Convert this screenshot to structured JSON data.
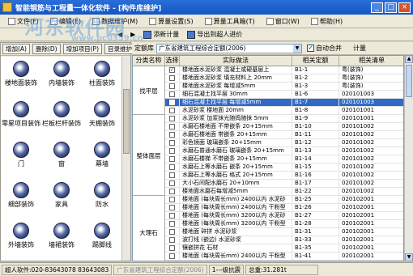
{
  "window": {
    "title": "智能钢筋与工程量一体化软件 - [构件库维护]",
    "buttons": {
      "minimize": "_",
      "maximize": "□",
      "close": "×"
    }
  },
  "watermark": {
    "main": "河东软件园",
    "url": "www.pc0359.cn"
  },
  "menu": [
    {
      "label": "文件(F)"
    },
    {
      "label": "编辑(E)"
    },
    {
      "label": "数据维护(M)"
    },
    {
      "label": "算量设置(S)"
    },
    {
      "label": "算量工具箱(T)"
    },
    {
      "label": "窗口(W)"
    },
    {
      "label": "帮助(H)"
    }
  ],
  "toolbar": {
    "items": [
      "添新计量",
      "导出到超人进价"
    ],
    "nav_icons": [
      "◀",
      "▶",
      "▶|"
    ]
  },
  "left_toolbar": {
    "buttons": [
      "增加(A)",
      "删除(D)",
      "增加项目(P)",
      "目录维护(M)"
    ]
  },
  "components": [
    {
      "label": "楼地面装饰"
    },
    {
      "label": "内墙装饰"
    },
    {
      "label": "柱面装饰"
    },
    {
      "label": "零星项目装饰"
    },
    {
      "label": "栏板栏杆装饰"
    },
    {
      "label": "天棚装饰"
    },
    {
      "label": "门"
    },
    {
      "label": "窗"
    },
    {
      "label": "幕墙"
    },
    {
      "label": "细部装饰"
    },
    {
      "label": "家具"
    },
    {
      "label": "防水"
    },
    {
      "label": "外墙装饰"
    },
    {
      "label": "墙裙装饰"
    },
    {
      "label": "踢脚线"
    }
  ],
  "filter": {
    "label": "定额库",
    "value": "广东省建筑工程综合定额(2006)",
    "auto_merge_label": "自动合并",
    "auto_merge_checked": true,
    "extra": "计量"
  },
  "table": {
    "headers": {
      "category": "分类名称",
      "select": "选择",
      "name": "实际做法",
      "code": "相关定额",
      "list": "相关清单"
    },
    "categories": [
      {
        "name": "找平层",
        "rows": 6
      },
      {
        "name": "整体面层",
        "rows": 10
      },
      {
        "name": "大理石",
        "rows": 9
      }
    ],
    "rows": [
      {
        "checked": true,
        "name": "楼地面水泥砂浆 混凝土或硬基层上",
        "code": "B1-1",
        "list": "粤(装饰)"
      },
      {
        "checked": false,
        "name": "楼地面水泥砂浆 填充材料上 20mm",
        "code": "B1-2",
        "list": "粤(装饰)"
      },
      {
        "checked": false,
        "name": "楼地面水泥砂浆 每增减5mm",
        "code": "B1-3",
        "list": "粤(装饰)"
      },
      {
        "checked": false,
        "name": "细石混凝土找平层 30mm",
        "code": "B1-6",
        "list": "020101003"
      },
      {
        "checked": false,
        "name": "细石混凝土找平层 每增减5mm",
        "code": "B1-7",
        "list": "020101003",
        "selected": true
      },
      {
        "checked": false,
        "name": "水泥砂浆 楼地面 20mm",
        "code": "B1-8",
        "list": "020101001"
      },
      {
        "checked": false,
        "name": "水泥砂浆 加浆抹光随捣随抹 5mm",
        "code": "B1-9",
        "list": "020101001"
      },
      {
        "checked": false,
        "name": "水磨石楼地面 不带嵌条 20+15mm",
        "code": "B1-10",
        "list": "020101002"
      },
      {
        "checked": false,
        "name": "水磨石楼地面 带嵌条 20+15mm",
        "code": "B1-11",
        "list": "020101002"
      },
      {
        "checked": false,
        "name": "彩色镜面 玻璃嵌条 20+15mm",
        "code": "B1-12",
        "list": "020101002"
      },
      {
        "checked": false,
        "name": "水磨石普通水磨石 玻璃嵌条 20+15mm",
        "code": "B1-13",
        "list": "020101002"
      },
      {
        "checked": false,
        "name": "水磨石楼梯 不带嵌条 20+15mm",
        "code": "B1-14",
        "list": "020101002"
      },
      {
        "checked": false,
        "name": "水磨石上等水磨石 嵌条 20+15mm",
        "code": "B1-15",
        "list": "020101002"
      },
      {
        "checked": false,
        "name": "水磨石上等水磨石 格式 20+15mm",
        "code": "B1-16",
        "list": "020101002"
      },
      {
        "checked": false,
        "name": "大小石间配水磨石 20+10mm",
        "code": "B1-17",
        "list": "020101002"
      },
      {
        "checked": false,
        "name": "楼地面水磨石每增减5mm",
        "code": "B1-22",
        "list": "020101002"
      },
      {
        "checked": false,
        "name": "楼地面 (每块周长mm) 2400以内 水泥砂",
        "code": "B1-25",
        "list": "020102001"
      },
      {
        "checked": false,
        "name": "楼地面 (每块周长mm) 2400以内 干粉型",
        "code": "B1-26",
        "list": "020102001"
      },
      {
        "checked": false,
        "name": "楼地面 (每块周长mm) 3200以内 水泥砂",
        "code": "B1-27",
        "list": "020102001"
      },
      {
        "checked": false,
        "name": "楼地面 (每块周长mm) 3200以内 干粉型",
        "code": "B1-28",
        "list": "020102001"
      },
      {
        "checked": false,
        "name": "楼地面 碎拼 水泥砂浆",
        "code": "B1-31",
        "list": "020102001"
      },
      {
        "checked": false,
        "name": "波打线 (嵌边) 水泥砂浆",
        "code": "B1-33",
        "list": "020102001"
      },
      {
        "checked": false,
        "name": "镶嵌拼花 石材",
        "code": "B1-35",
        "list": "020102001"
      },
      {
        "checked": false,
        "name": "楼地面 (每块周长mm) 2400以内 干粉型",
        "code": "B1-41",
        "list": "020102001"
      },
      {
        "checked": false,
        "name": "楼地面 (每块周长mm) 3200以内 干粉型",
        "code": "B1-43",
        "list": "020102001"
      }
    ]
  },
  "status": {
    "hotline": "超人软件:020-83643078 83643083",
    "library": "广东省建筑工程综合定额(2006)",
    "seismic": "1---级抗震",
    "total": "总重:31.281t"
  },
  "colors": {
    "titlebar": "#1456c4",
    "selected_row": "#316ac5",
    "chrome": "#ece9d8"
  }
}
